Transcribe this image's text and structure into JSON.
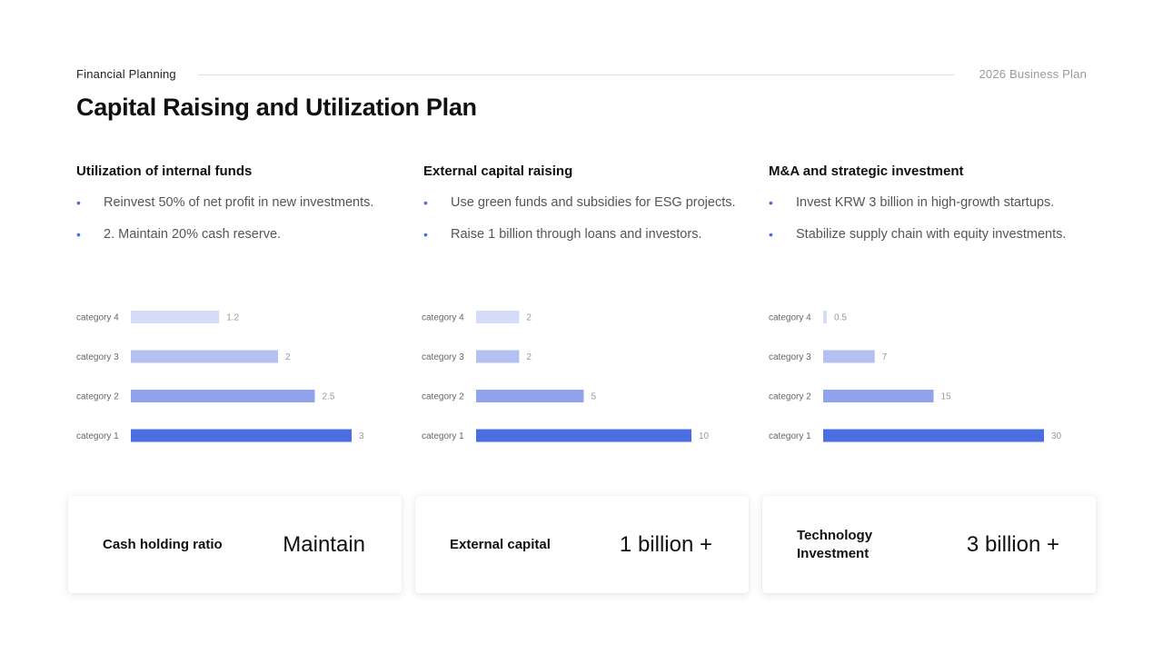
{
  "header": {
    "kicker": "Financial  Planning",
    "plan": "2026 Business  Plan",
    "title": "Capital Raising and Utilization Plan"
  },
  "columns": [
    {
      "title": "Utilization of internal funds",
      "bullets": [
        "Reinvest 50% of net profit in new investments.",
        "2. Maintain 20% cash reserve."
      ]
    },
    {
      "title": "External capital raising",
      "bullets": [
        "Use green funds and subsidies for ESG projects.",
        "Raise 1 billion through loans and investors."
      ]
    },
    {
      "title": "M&A and strategic investment",
      "bullets": [
        "Invest KRW 3 billion in high-growth startups.",
        "Stabilize supply chain with equity investments."
      ]
    }
  ],
  "chart_data": [
    {
      "type": "bar",
      "orientation": "horizontal",
      "categories": [
        "category 4",
        "category 3",
        "category 2",
        "category 1"
      ],
      "values": [
        1.2,
        2,
        2.5,
        3
      ],
      "value_labels": [
        "1.2",
        "2",
        "2.5",
        "3"
      ]
    },
    {
      "type": "bar",
      "orientation": "horizontal",
      "categories": [
        "category 4",
        "category 3",
        "category 2",
        "category 1"
      ],
      "values": [
        2,
        2,
        5,
        10
      ],
      "value_labels": [
        "2",
        "2",
        "5",
        "10"
      ]
    },
    {
      "type": "bar",
      "orientation": "horizontal",
      "categories": [
        "category 4",
        "category 3",
        "category 2",
        "category 1"
      ],
      "values": [
        0.5,
        7,
        15,
        30
      ],
      "value_labels": [
        "0.5",
        "7",
        "15",
        "30"
      ]
    }
  ],
  "bar_colors": [
    "#d5dcf7",
    "#b4c0f2",
    "#8fa4ec",
    "#4a6ee0"
  ],
  "cards": [
    {
      "label": "Cash holding ratio",
      "value": "Maintain"
    },
    {
      "label": "External capital",
      "value": "1 billion +"
    },
    {
      "label": "Technology Investment",
      "value": "3 billion +"
    }
  ]
}
